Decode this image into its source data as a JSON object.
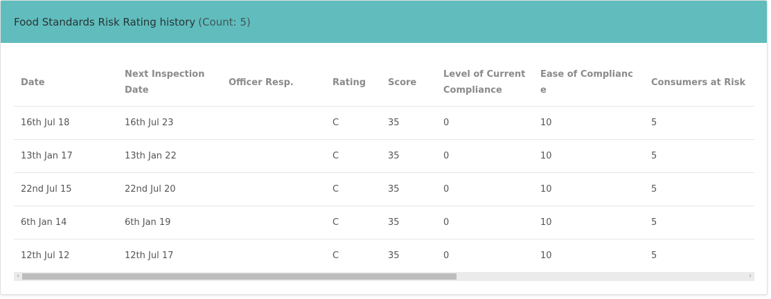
{
  "panel": {
    "title": "Food Standards Risk Rating history",
    "count": "(Count: 5)"
  },
  "table": {
    "headers": {
      "date": "Date",
      "next_inspection": "Next Inspection Date",
      "officer": "Officer Resp.",
      "rating": "Rating",
      "score": "Score",
      "level": "Level of Current Compliance",
      "ease": "Ease of Compliance",
      "consumers": "Consumers at Risk"
    },
    "rows": [
      {
        "date": "16th Jul 18",
        "next": "16th Jul 23",
        "officer": "",
        "rating": "C",
        "score": "35",
        "level": "0",
        "ease": "10",
        "consumers": "5"
      },
      {
        "date": "13th Jan 17",
        "next": "13th Jan 22",
        "officer": "",
        "rating": "C",
        "score": "35",
        "level": "0",
        "ease": "10",
        "consumers": "5"
      },
      {
        "date": "22nd Jul 15",
        "next": "22nd Jul 20",
        "officer": "",
        "rating": "C",
        "score": "35",
        "level": "0",
        "ease": "10",
        "consumers": "5"
      },
      {
        "date": "6th Jan 14",
        "next": "6th Jan 19",
        "officer": "",
        "rating": "C",
        "score": "35",
        "level": "0",
        "ease": "10",
        "consumers": "5"
      },
      {
        "date": "12th Jul 12",
        "next": "12th Jul 17",
        "officer": "",
        "rating": "C",
        "score": "35",
        "level": "0",
        "ease": "10",
        "consumers": "5"
      }
    ]
  },
  "scrollbar": {
    "left_arrow": "‹",
    "right_arrow": "›",
    "position_fraction": 0.0,
    "visible_fraction": 0.6
  },
  "colors": {
    "header_bg": "#61bcbd",
    "header_text": "#253535"
  }
}
